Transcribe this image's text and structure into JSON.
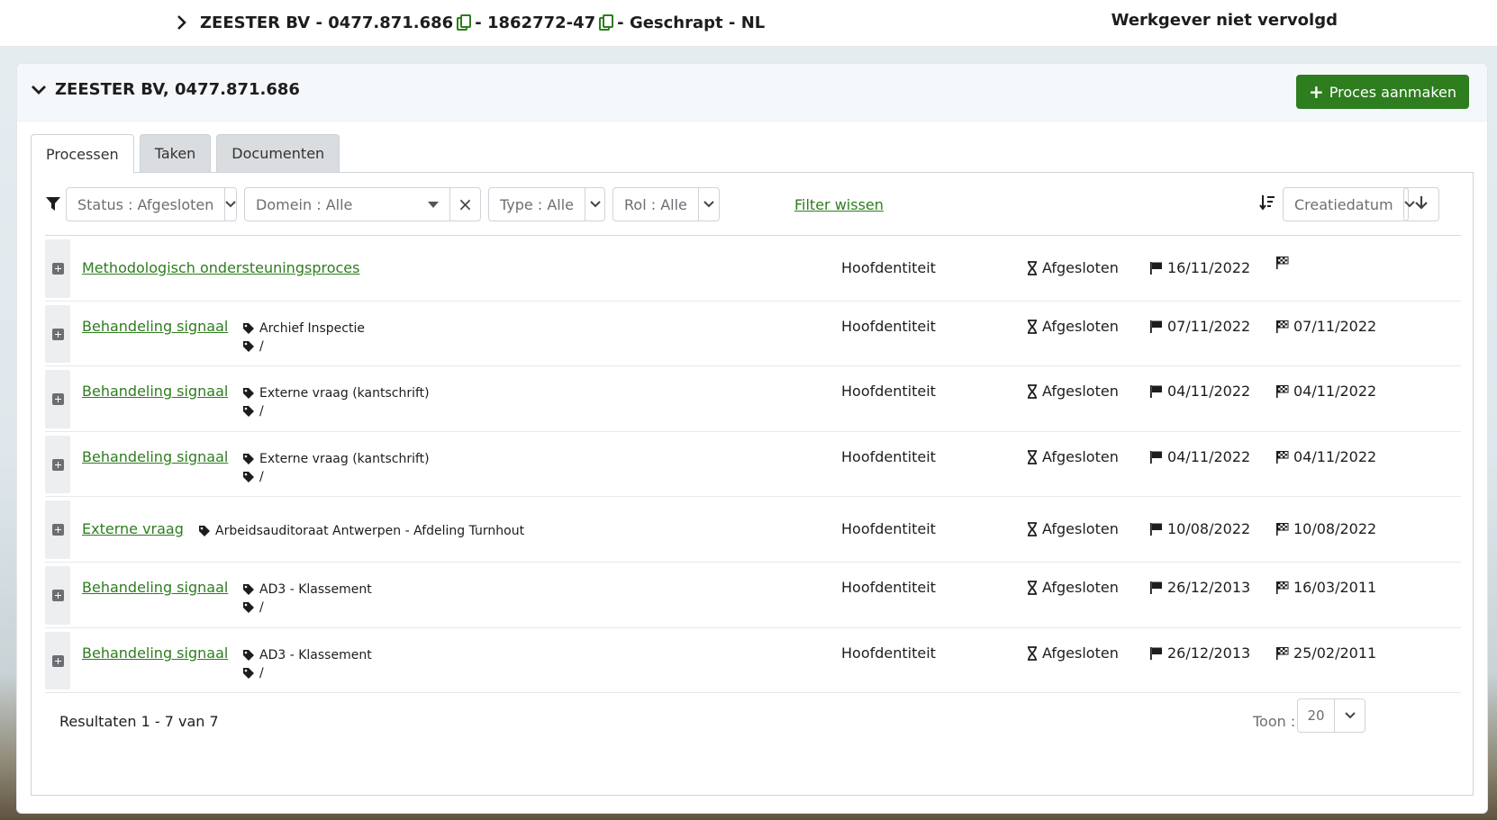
{
  "header": {
    "name": "ZEESTER BV",
    "sep": "-",
    "kbo": "0477.871.686",
    "id": "1862772-47",
    "status": "Geschrapt",
    "lang": "NL",
    "right_text": "Werkgever niet vervolgd"
  },
  "card": {
    "title": "ZEESTER BV, 0477.871.686",
    "create_button": "Proces aanmaken"
  },
  "tabs": [
    {
      "label": "Processen",
      "active": true
    },
    {
      "label": "Taken",
      "active": false
    },
    {
      "label": "Documenten",
      "active": false
    }
  ],
  "filters": {
    "status": "Status : Afgesloten",
    "domain": "Domein : Alle",
    "type": "Type : Alle",
    "role": "Rol : Alle",
    "clear_link": "Filter wissen",
    "sort_field": "Creatiedatum"
  },
  "rows": [
    {
      "title": "Methodologisch ondersteuningsproces",
      "tags": [],
      "entity": "Hoofdentiteit",
      "state": "Afgesloten",
      "start": "16/11/2022",
      "end": ""
    },
    {
      "title": "Behandeling signaal",
      "tags": [
        "Archief Inspectie",
        "/"
      ],
      "entity": "Hoofdentiteit",
      "state": "Afgesloten",
      "start": "07/11/2022",
      "end": "07/11/2022"
    },
    {
      "title": "Behandeling signaal",
      "tags": [
        "Externe vraag (kantschrift)",
        "/"
      ],
      "entity": "Hoofdentiteit",
      "state": "Afgesloten",
      "start": "04/11/2022",
      "end": "04/11/2022"
    },
    {
      "title": "Behandeling signaal",
      "tags": [
        "Externe vraag (kantschrift)",
        "/"
      ],
      "entity": "Hoofdentiteit",
      "state": "Afgesloten",
      "start": "04/11/2022",
      "end": "04/11/2022"
    },
    {
      "title": "Externe vraag",
      "tags": [
        "Arbeidsauditoraat Antwerpen - Afdeling Turnhout"
      ],
      "entity": "Hoofdentiteit",
      "state": "Afgesloten",
      "start": "10/08/2022",
      "end": "10/08/2022"
    },
    {
      "title": "Behandeling signaal",
      "tags": [
        "AD3 - Klassement",
        "/"
      ],
      "entity": "Hoofdentiteit",
      "state": "Afgesloten",
      "start": "26/12/2013",
      "end": "16/03/2011"
    },
    {
      "title": "Behandeling signaal",
      "tags": [
        "AD3 - Klassement",
        "/"
      ],
      "entity": "Hoofdentiteit",
      "state": "Afgesloten",
      "start": "26/12/2013",
      "end": "25/02/2011"
    }
  ],
  "footer": {
    "results": "Resultaten 1 - 7 van 7",
    "show_label": "Toon :",
    "page_size": "20"
  },
  "colors": {
    "accent_green": "#2e7d1f",
    "tab_inactive": "#d9dde0"
  }
}
